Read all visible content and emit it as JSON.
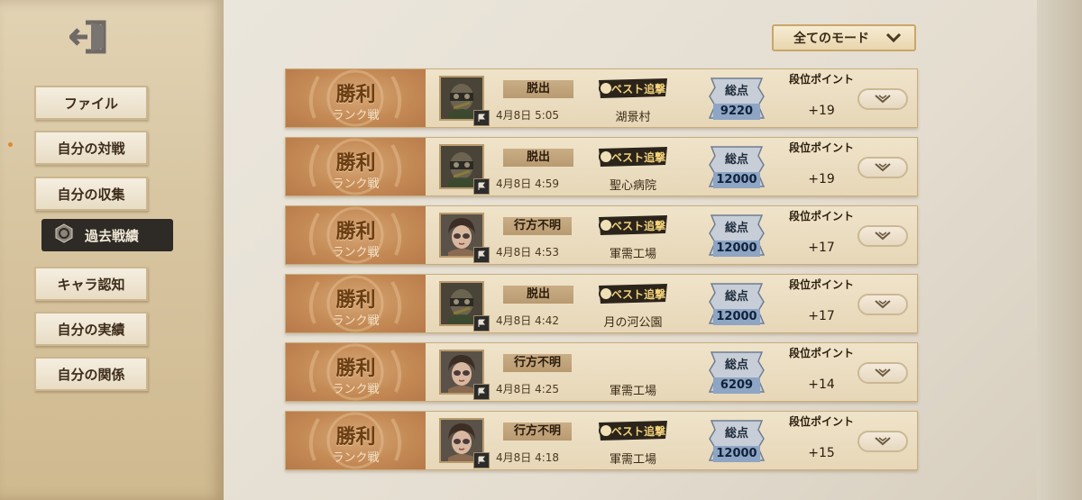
{
  "sidebar": {
    "items": [
      {
        "label": "ファイル"
      },
      {
        "label": "自分の対戦"
      },
      {
        "label": "自分の収集"
      },
      {
        "label": "過去戦績"
      },
      {
        "label": "キャラ認知"
      },
      {
        "label": "自分の実績"
      },
      {
        "label": "自分の関係"
      }
    ]
  },
  "mode_filter": {
    "label": "全てのモード"
  },
  "columns": {
    "score_label": "総点",
    "points_label": "段位ポイント"
  },
  "badge_text": "ベスト追撃",
  "rows": [
    {
      "result": "勝利",
      "mode": "ランク戦",
      "outcome": "脱出",
      "time": "4月8日 5:05",
      "map": "湖景村",
      "best": true,
      "score": "9220",
      "points": "+19",
      "avatar": "masked"
    },
    {
      "result": "勝利",
      "mode": "ランク戦",
      "outcome": "脱出",
      "time": "4月8日 4:59",
      "map": "聖心病院",
      "best": true,
      "score": "12000",
      "points": "+19",
      "avatar": "masked"
    },
    {
      "result": "勝利",
      "mode": "ランク戦",
      "outcome": "行方不明",
      "time": "4月8日 4:53",
      "map": "軍需工場",
      "best": true,
      "score": "12000",
      "points": "+17",
      "avatar": "girl"
    },
    {
      "result": "勝利",
      "mode": "ランク戦",
      "outcome": "脱出",
      "time": "4月8日 4:42",
      "map": "月の河公園",
      "best": true,
      "score": "12000",
      "points": "+17",
      "avatar": "masked"
    },
    {
      "result": "勝利",
      "mode": "ランク戦",
      "outcome": "行方不明",
      "time": "4月8日 4:25",
      "map": "軍需工場",
      "best": false,
      "score": "6209",
      "points": "+14",
      "avatar": "girl"
    },
    {
      "result": "勝利",
      "mode": "ランク戦",
      "outcome": "行方不明",
      "time": "4月8日 4:18",
      "map": "軍需工場",
      "best": true,
      "score": "12000",
      "points": "+15",
      "avatar": "girl"
    }
  ]
}
